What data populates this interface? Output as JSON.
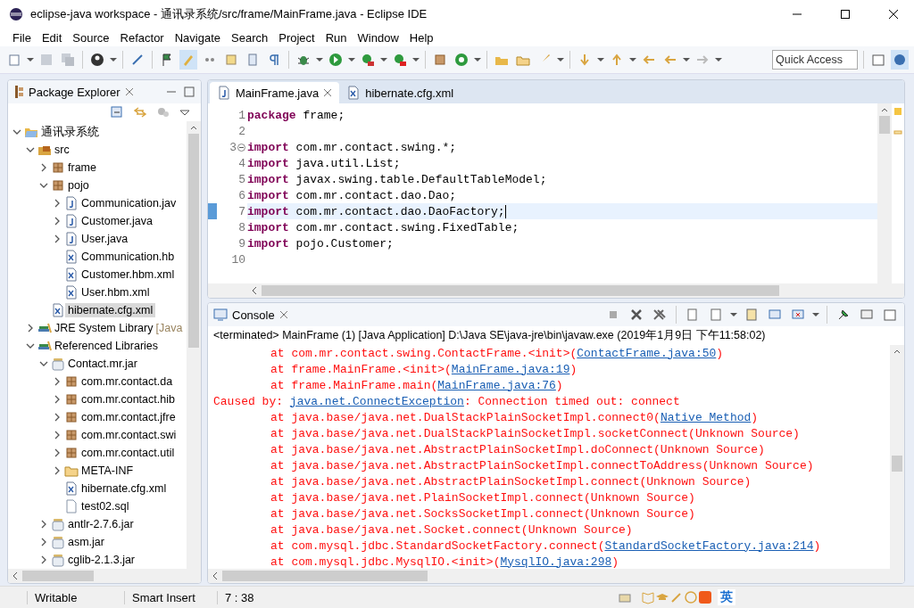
{
  "window": {
    "title": "eclipse-java workspace - 通讯录系统/src/frame/MainFrame.java - Eclipse IDE"
  },
  "menu": [
    "File",
    "Edit",
    "Source",
    "Refactor",
    "Navigate",
    "Search",
    "Project",
    "Run",
    "Window",
    "Help"
  ],
  "toolbar": {
    "quick_access": {
      "placeholder": "Quick Access"
    }
  },
  "package_explorer": {
    "title": "Package Explorer",
    "tree": [
      {
        "label": "通讯录系统",
        "kind": "project",
        "expanded": true,
        "selected": false,
        "children": [
          {
            "label": "src",
            "kind": "source",
            "expanded": true,
            "selected": false,
            "children": [
              {
                "label": "frame",
                "kind": "package",
                "expanded": false,
                "selected": false
              },
              {
                "label": "pojo",
                "kind": "package",
                "expanded": true,
                "selected": false,
                "children": [
                  {
                    "label": "Communication.jav",
                    "kind": "java",
                    "expanded": false,
                    "selected": false
                  },
                  {
                    "label": "Customer.java",
                    "kind": "java",
                    "expanded": false,
                    "selected": false
                  },
                  {
                    "label": "User.java",
                    "kind": "java",
                    "expanded": false,
                    "selected": false
                  },
                  {
                    "label": "Communication.hb",
                    "kind": "xml",
                    "selected": false
                  },
                  {
                    "label": "Customer.hbm.xml",
                    "kind": "xml",
                    "selected": false
                  },
                  {
                    "label": "User.hbm.xml",
                    "kind": "xml",
                    "selected": false
                  }
                ]
              },
              {
                "label": "hibernate.cfg.xml",
                "kind": "xml",
                "selected": true
              }
            ]
          },
          {
            "label": "JRE System Library",
            "decoration": "[Java",
            "kind": "library",
            "expanded": false,
            "selected": false
          },
          {
            "label": "Referenced Libraries",
            "kind": "library",
            "expanded": true,
            "selected": false,
            "children": [
              {
                "label": "Contact.mr.jar",
                "kind": "jar",
                "expanded": true,
                "selected": false,
                "children": [
                  {
                    "label": "com.mr.contact.da",
                    "kind": "package",
                    "expanded": false,
                    "selected": false
                  },
                  {
                    "label": "com.mr.contact.hib",
                    "kind": "package",
                    "expanded": false,
                    "selected": false
                  },
                  {
                    "label": "com.mr.contact.jfre",
                    "kind": "package",
                    "expanded": false,
                    "selected": false
                  },
                  {
                    "label": "com.mr.contact.swi",
                    "kind": "package",
                    "expanded": false,
                    "selected": false
                  },
                  {
                    "label": "com.mr.contact.util",
                    "kind": "package",
                    "expanded": false,
                    "selected": false
                  },
                  {
                    "label": "META-INF",
                    "kind": "folder",
                    "expanded": false,
                    "selected": false
                  },
                  {
                    "label": "hibernate.cfg.xml",
                    "kind": "xml",
                    "selected": false
                  },
                  {
                    "label": "test02.sql",
                    "kind": "file",
                    "selected": false
                  }
                ]
              },
              {
                "label": "antlr-2.7.6.jar",
                "kind": "jar",
                "expanded": false,
                "selected": false
              },
              {
                "label": "asm.jar",
                "kind": "jar",
                "expanded": false,
                "selected": false
              },
              {
                "label": "cglib-2.1.3.jar",
                "kind": "jar",
                "expanded": false,
                "selected": false
              }
            ]
          }
        ]
      }
    ]
  },
  "editor": {
    "tabs": [
      {
        "label": "MainFrame.java",
        "kind": "java",
        "selected": true
      },
      {
        "label": "hibernate.cfg.xml",
        "kind": "xml",
        "selected": false
      }
    ],
    "lines": [
      {
        "number": "1",
        "keyword": "package",
        "code": "frame;",
        "current": false
      },
      {
        "number": "2",
        "current": false
      },
      {
        "number": "3",
        "keyword": "import",
        "code": "com.mr.contact.swing.*;",
        "folded": false,
        "current": false
      },
      {
        "number": "4",
        "keyword": "import",
        "code": "java.util.List;",
        "current": false
      },
      {
        "number": "5",
        "keyword": "import",
        "code": "javax.swing.table.DefaultTableModel;",
        "current": false
      },
      {
        "number": "6",
        "keyword": "import",
        "code": "com.mr.contact.dao.Dao;",
        "current": false
      },
      {
        "number": "7",
        "keyword": "import",
        "code": "com.mr.contact.dao.DaoFactory;",
        "current": true
      },
      {
        "number": "8",
        "keyword": "import",
        "code": "com.mr.contact.swing.FixedTable;",
        "current": false
      },
      {
        "number": "9",
        "keyword": "import",
        "code": "pojo.Customer;",
        "current": false
      },
      {
        "number": "10",
        "current": false
      }
    ]
  },
  "console": {
    "title": "Console",
    "status": "<terminated> MainFrame (1) [Java Application] D:\\Java SE\\java-jre\\bin\\javaw.exe (2019年1月9日 下午11:58:02)",
    "lines": [
      {
        "kind": "frame",
        "segments": [
          {
            "text": "at com.mr.contact.swing.ContactFrame.<init>(",
            "link": false
          },
          {
            "text": "ContactFrame.java:50",
            "link": true
          },
          {
            "text": ")",
            "link": false
          }
        ]
      },
      {
        "kind": "frame",
        "segments": [
          {
            "text": "at frame.MainFrame.<init>(",
            "link": false
          },
          {
            "text": "MainFrame.java:19",
            "link": true
          },
          {
            "text": ")",
            "link": false
          }
        ]
      },
      {
        "kind": "frame",
        "segments": [
          {
            "text": "at frame.MainFrame.main(",
            "link": false
          },
          {
            "text": "MainFrame.java:76",
            "link": true
          },
          {
            "text": ")",
            "link": false
          }
        ]
      },
      {
        "kind": "cause",
        "segments": [
          {
            "text": "Caused by: ",
            "link": false
          },
          {
            "text": "java.net.ConnectException",
            "link": true
          },
          {
            "text": ": Connection timed out: connect",
            "link": false
          }
        ]
      },
      {
        "kind": "frame",
        "segments": [
          {
            "text": "at java.base/java.net.DualStackPlainSocketImpl.connect0(",
            "link": false
          },
          {
            "text": "Native Method",
            "link": true
          },
          {
            "text": ")",
            "link": false
          }
        ]
      },
      {
        "kind": "frame",
        "segments": [
          {
            "text": "at java.base/java.net.DualStackPlainSocketImpl.socketConnect(Unknown Source)",
            "link": false
          }
        ]
      },
      {
        "kind": "frame",
        "segments": [
          {
            "text": "at java.base/java.net.AbstractPlainSocketImpl.doConnect(Unknown Source)",
            "link": false
          }
        ]
      },
      {
        "kind": "frame",
        "segments": [
          {
            "text": "at java.base/java.net.AbstractPlainSocketImpl.connectToAddress(Unknown Source)",
            "link": false
          }
        ]
      },
      {
        "kind": "frame",
        "segments": [
          {
            "text": "at java.base/java.net.AbstractPlainSocketImpl.connect(Unknown Source)",
            "link": false
          }
        ]
      },
      {
        "kind": "frame",
        "segments": [
          {
            "text": "at java.base/java.net.PlainSocketImpl.connect(Unknown Source)",
            "link": false
          }
        ]
      },
      {
        "kind": "frame",
        "segments": [
          {
            "text": "at java.base/java.net.SocksSocketImpl.connect(Unknown Source)",
            "link": false
          }
        ]
      },
      {
        "kind": "frame",
        "segments": [
          {
            "text": "at java.base/java.net.Socket.connect(Unknown Source)",
            "link": false
          }
        ]
      },
      {
        "kind": "frame",
        "segments": [
          {
            "text": "at com.mysql.jdbc.StandardSocketFactory.connect(",
            "link": false
          },
          {
            "text": "StandardSocketFactory.java:214",
            "link": true
          },
          {
            "text": ")",
            "link": false
          }
        ]
      },
      {
        "kind": "frame",
        "segments": [
          {
            "text": "at com.mysql.jdbc.MysqlIO.<init>(",
            "link": false
          },
          {
            "text": "MysqlIO.java:298",
            "link": true
          },
          {
            "text": ")",
            "link": false
          }
        ]
      }
    ]
  },
  "status_bar": {
    "fields": [
      "Writable",
      "Smart Insert",
      "7 : 38"
    ],
    "ime": "英"
  }
}
